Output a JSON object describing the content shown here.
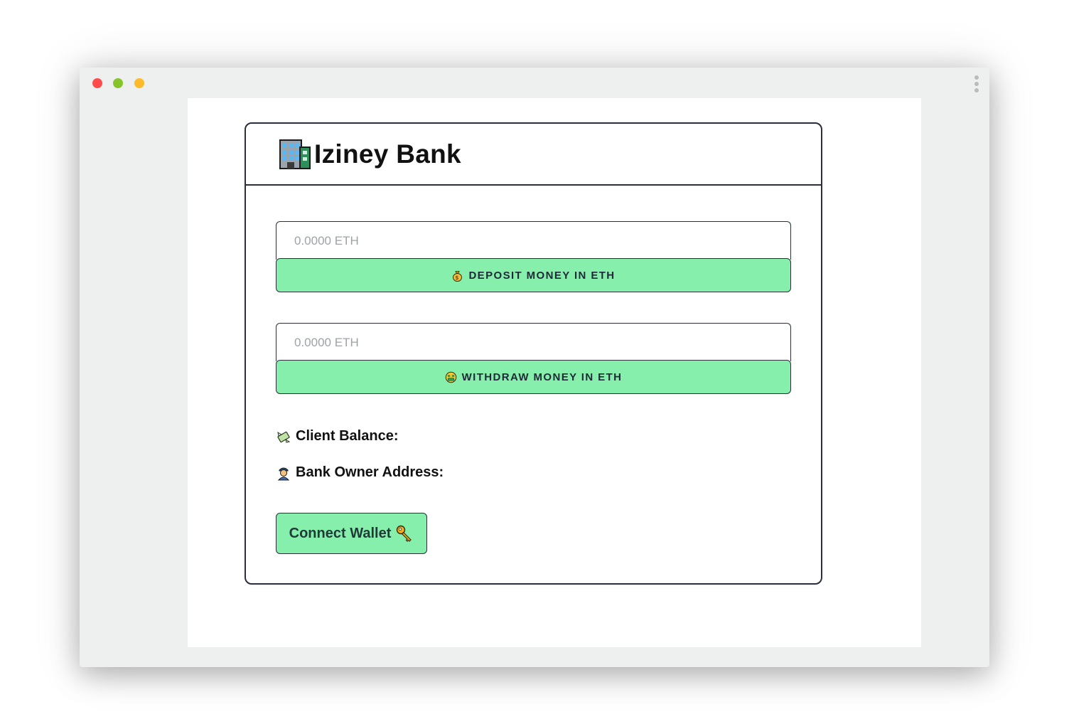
{
  "app": {
    "title": "Iziney Bank"
  },
  "icons": {
    "logo": "office-building-icon",
    "deposit": "money-bag-icon",
    "withdraw": "money-mouth-face-icon",
    "balance": "money-with-wings-icon",
    "owner": "police-officer-icon",
    "connect": "key-icon"
  },
  "deposit": {
    "placeholder": "0.0000 ETH",
    "button_label": "Deposit money in ETH"
  },
  "withdraw": {
    "placeholder": "0.0000 ETH",
    "button_label": "Withdraw money in ETH"
  },
  "info": {
    "balance_label": "Client Balance:",
    "owner_label": "Bank Owner Address:"
  },
  "wallet": {
    "connect_label": "Connect Wallet"
  },
  "colors": {
    "accent_green": "#86efac",
    "border": "#2b2f3a",
    "traffic_red": "#fe4c4c",
    "traffic_green": "#87c42a",
    "traffic_yellow": "#fdbb2c"
  }
}
